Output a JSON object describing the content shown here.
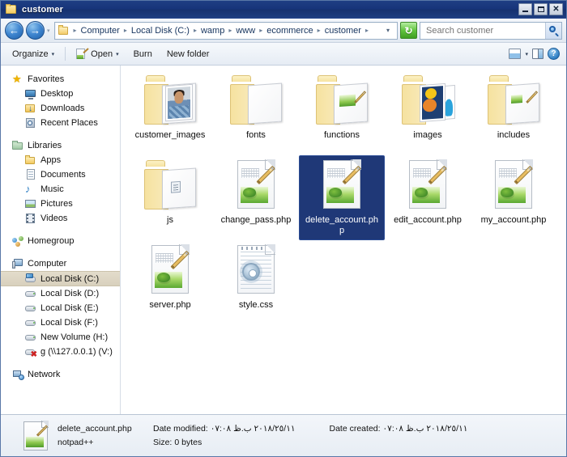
{
  "window": {
    "title": "customer",
    "minimize_label": "Minimize",
    "maximize_label": "Maximize",
    "close_label": "Close"
  },
  "address_bar": {
    "back_glyph": "←",
    "forward_glyph": "→",
    "recent_glyph": "▾",
    "breadcrumbs": [
      "Computer",
      "Local Disk (C:)",
      "wamp",
      "www",
      "ecommerce",
      "customer"
    ],
    "separator": "▸",
    "dropdown_glyph": "▾",
    "refresh_glyph": "↻",
    "search_placeholder": "Search customer",
    "search_value": ""
  },
  "toolbar": {
    "organize_label": "Organize",
    "open_label": "Open",
    "burn_label": "Burn",
    "new_folder_label": "New folder",
    "caret": "▾",
    "help_label": "?"
  },
  "nav_pane": {
    "groups": [
      {
        "header": "Favorites",
        "icon": "star-icon",
        "items": [
          {
            "label": "Desktop",
            "icon": "desktop-icon"
          },
          {
            "label": "Downloads",
            "icon": "downloads-icon"
          },
          {
            "label": "Recent Places",
            "icon": "recent-places-icon"
          }
        ]
      },
      {
        "header": "Libraries",
        "icon": "libraries-icon",
        "items": [
          {
            "label": "Apps",
            "icon": "folder-icon"
          },
          {
            "label": "Documents",
            "icon": "documents-icon"
          },
          {
            "label": "Music",
            "icon": "music-icon"
          },
          {
            "label": "Pictures",
            "icon": "pictures-icon"
          },
          {
            "label": "Videos",
            "icon": "videos-icon"
          }
        ]
      },
      {
        "header": "Homegroup",
        "icon": "homegroup-icon",
        "items": []
      },
      {
        "header": "Computer",
        "icon": "computer-icon",
        "items": [
          {
            "label": "Local Disk (C:)",
            "icon": "system-disk-icon",
            "selected": true
          },
          {
            "label": "Local Disk (D:)",
            "icon": "hard-disk-icon"
          },
          {
            "label": "Local Disk (E:)",
            "icon": "hard-disk-icon"
          },
          {
            "label": "Local Disk (F:)",
            "icon": "hard-disk-icon"
          },
          {
            "label": "New Volume (H:)",
            "icon": "hard-disk-icon"
          },
          {
            "label": "g (\\\\127.0.0.1) (V:)",
            "icon": "network-drive-disconnected-icon"
          }
        ]
      },
      {
        "header": "Network",
        "icon": "network-icon",
        "items": []
      }
    ]
  },
  "file_list": {
    "items": [
      {
        "name": "customer_images",
        "type": "folder",
        "variant": "photo",
        "selected": false
      },
      {
        "name": "fonts",
        "type": "folder",
        "variant": "papers",
        "selected": false
      },
      {
        "name": "functions",
        "type": "folder",
        "variant": "php",
        "selected": false
      },
      {
        "name": "images",
        "type": "folder",
        "variant": "images",
        "selected": false
      },
      {
        "name": "includes",
        "type": "folder",
        "variant": "php2",
        "selected": false
      },
      {
        "name": "js",
        "type": "folder",
        "variant": "js",
        "selected": false
      },
      {
        "name": "change_pass.php",
        "type": "php",
        "variant": "",
        "selected": false
      },
      {
        "name": "delete_account.php",
        "type": "php",
        "variant": "",
        "selected": true
      },
      {
        "name": "edit_account.php",
        "type": "php",
        "variant": "",
        "selected": false
      },
      {
        "name": "my_account.php",
        "type": "php",
        "variant": "",
        "selected": false
      },
      {
        "name": "server.php",
        "type": "php",
        "variant": "",
        "selected": false
      },
      {
        "name": "style.css",
        "type": "css",
        "variant": "",
        "selected": false
      }
    ]
  },
  "details_pane": {
    "file_name": "delete_account.php",
    "file_type": "notpad++",
    "date_modified_label": "Date modified:",
    "date_modified_value": "٢٠١٨/٢٥/١١ ب.ظ ٠٧:٠٨",
    "date_created_label": "Date created:",
    "date_created_value": "٢٠١٨/٢٥/١١ ب.ظ ٠٧:٠٨",
    "size_label": "Size:",
    "size_value": "0 bytes"
  },
  "colors": {
    "titlebar": "#17347a",
    "selection": "#1f3877",
    "nav_selection": "#ddd5c3",
    "accent_green": "#5fc23c",
    "accent_blue": "#2f7fc4"
  }
}
